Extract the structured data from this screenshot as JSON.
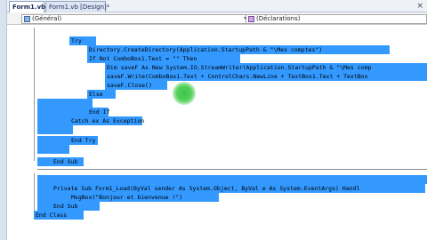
{
  "tabs": [
    {
      "label": "Form1.vb*",
      "active": true
    },
    {
      "label": "Form1.vb [Design]*",
      "active": false
    }
  ],
  "close_glyph": "×",
  "combo_left": {
    "value": "(Général)"
  },
  "combo_right": {
    "value": "(Déclarations)"
  },
  "code": [
    "Try",
    "Directory.CreateDirectory(Application.StartupPath & \"\\Mes comptes\")",
    "If Not ComboBox1.Text = \"\" Then",
    "Dim saveF As New System.IO.StreamWriter(Application.StartupPath & \"\\Mes comp",
    "saveF.Write(ComboBox1.Text + ControlChars.NewLine + TextBox1.Text + TextBox",
    "saveF.Close()",
    "Else",
    "",
    "End If",
    "Catch ex As Exception",
    "",
    "End Try",
    "",
    "End Sub",
    "",
    "Private Sub Form1_Load(ByVal sender As System.Object, ByVal e As System.EventArgs) Handl",
    "MsgBox(\"Bonjour et bienvenue !\")",
    "End Sub",
    "End Class"
  ],
  "colors": {
    "selection": "#3399ff",
    "code_text": "#0b1a55",
    "cursor_highlight": "#53d25a"
  }
}
